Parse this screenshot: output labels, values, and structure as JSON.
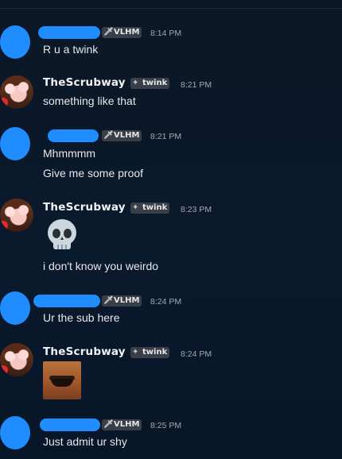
{
  "messages": [
    {
      "author": "",
      "tag": "VLHM",
      "time": "8:14 PM",
      "lines": [
        "R u a twink"
      ]
    },
    {
      "author": "TheScrubway",
      "tag": "twink",
      "time": "8:21 PM",
      "lines": [
        "something like that"
      ]
    },
    {
      "author": "",
      "tag": "VLHM",
      "time": "8:21 PM",
      "lines": [
        "Mhmmmm",
        "Give me some proof"
      ]
    },
    {
      "author": "TheScrubway",
      "tag": "twink",
      "time": "8:23 PM",
      "emoji": "skull",
      "lines": [
        "i don't know you weirdo"
      ]
    },
    {
      "author": "",
      "tag": "VLHM",
      "time": "8:24 PM",
      "lines": [
        "Ur the sub here"
      ]
    },
    {
      "author": "TheScrubway",
      "tag": "twink",
      "time": "8:24 PM",
      "image": "laughing-man-reaction"
    },
    {
      "author": "",
      "tag": "VLHM",
      "time": "8:25 PM",
      "lines": [
        "Just admit ur shy"
      ]
    }
  ],
  "icons": {
    "vlhm_tag": "sword-icon",
    "twink_tag": "sparkle-icon"
  }
}
